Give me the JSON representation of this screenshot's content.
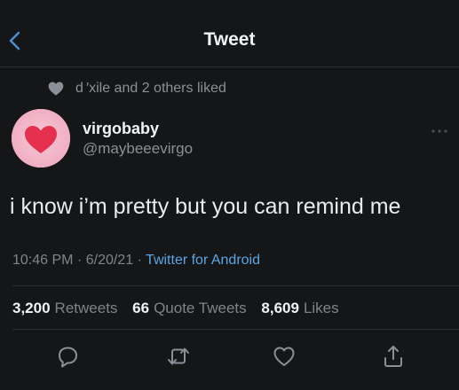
{
  "header": {
    "title": "Tweet",
    "back_icon": "chevron-left-icon"
  },
  "social_context": {
    "text": "d ′xile and 2 others liked",
    "icon": "heart-icon"
  },
  "author": {
    "display_name": "virgobaby",
    "handle": "@maybeeevirgo",
    "avatar": "pink-heart-avatar"
  },
  "tweet": {
    "text": "i know i’m pretty but you can remind me",
    "time": "10:46 PM",
    "date": "6/20/21",
    "separator": "·",
    "source": "Twitter for Android"
  },
  "stats": {
    "retweets_count": "3,200",
    "retweets_label": "Retweets",
    "quotes_count": "66",
    "quotes_label": "Quote Tweets",
    "likes_count": "8,609",
    "likes_label": "Likes"
  },
  "actions": {
    "reply_icon": "reply-icon",
    "retweet_icon": "retweet-icon",
    "like_icon": "heart-outline-icon",
    "share_icon": "share-icon"
  },
  "colors": {
    "background": "#151617",
    "accent": "#5aa6e6",
    "muted_text": "#7f848a",
    "avatar_bg": "#f2b7c9",
    "avatar_heart": "#e5304f"
  }
}
